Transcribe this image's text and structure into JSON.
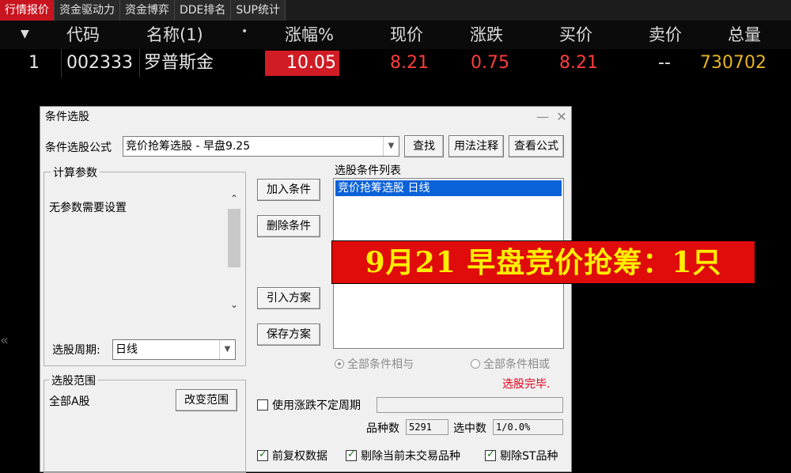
{
  "tabs": [
    "行情报价",
    "资金驱动力",
    "资金博弈",
    "DDE排名",
    "SUP统计"
  ],
  "quote_table": {
    "headers": {
      "code": "代码",
      "name": "名称(1)",
      "change_pct": "涨幅%",
      "price": "现价",
      "change": "涨跌",
      "bid": "买价",
      "ask": "卖价",
      "volume": "总量"
    },
    "row": {
      "index": "1",
      "code": "002333",
      "name": "罗普斯金",
      "change_pct": "10.05",
      "price": "8.21",
      "change": "0.75",
      "bid": "8.21",
      "ask": "--",
      "volume": "730702"
    }
  },
  "dialog": {
    "title": "条件选股",
    "formula_label": "条件选股公式",
    "formula_value": "竞价抢筹选股  -  早盘9.25",
    "find_button": "查找",
    "usage_button": "用法注释",
    "view_formula_button": "查看公式",
    "params_group": "计算参数",
    "params_text": "无参数需要设置",
    "period_label": "选股周期:",
    "period_value": "日线",
    "add_button": "加入条件",
    "delete_button": "删除条件",
    "import_button": "引入方案",
    "save_button": "保存方案",
    "condition_list_label": "选股条件列表",
    "condition_item": "竞价抢筹选股  日线",
    "radio_and": "全部条件相与",
    "radio_or": "全部条件相或",
    "status": "选股完毕.",
    "range_group": "选股范围",
    "range_value": "全部A股",
    "change_range_button": "改变范围",
    "variable_period_label": "使用涨跌不定周期",
    "count_label": "品种数",
    "count_value": "5291",
    "selected_label": "选中数",
    "selected_value": "1/0.0%",
    "chk_adjust": "前复权数据",
    "chk_exclude_untraded": "剔除当前未交易品种",
    "chk_exclude_st": "剔除ST品种"
  },
  "banner": "9月21 早盘竞价抢筹：1只",
  "colors": {
    "accent_red": "#c8141e",
    "rise_red": "#ff3c3c",
    "volume_gold": "#e6b422",
    "banner_text": "#ffef00",
    "selection_blue": "#0a62d8"
  }
}
